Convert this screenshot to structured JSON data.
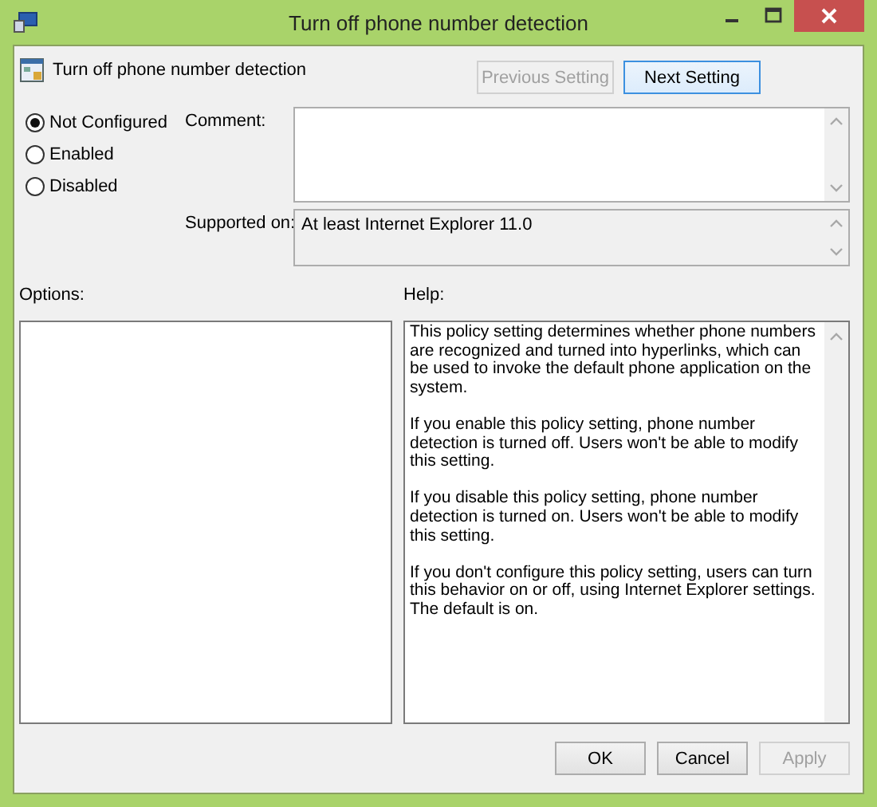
{
  "window": {
    "title": "Turn off phone number detection"
  },
  "policy_name": "Turn off phone number detection",
  "nav_buttons": [
    {
      "label": "Previous Setting",
      "disabled": true
    },
    {
      "label": "Next Setting",
      "disabled": false
    }
  ],
  "states": [
    {
      "label": "Not Configured",
      "selected": true
    },
    {
      "label": "Enabled",
      "selected": false
    },
    {
      "label": "Disabled",
      "selected": false
    }
  ],
  "comment": {
    "label": "Comment:"
  },
  "supported_on": {
    "label": "Supported on:",
    "value": "At least Internet Explorer 11.0"
  },
  "options": {
    "label": "Options:"
  },
  "help": {
    "label": "Help:",
    "paragraphs": [
      "This policy setting determines whether phone numbers are recognized and turned into hyperlinks, which can be used to invoke the default phone application on the system.",
      "If you enable this policy setting, phone number detection is turned off. Users won't be able to modify this setting.",
      "If you disable this policy setting, phone number detection is turned on. Users won't be able to modify this setting.",
      "If you don't configure this policy setting, users can turn this behavior on or off, using Internet Explorer settings. The default is on."
    ]
  },
  "buttons": [
    {
      "label": "OK",
      "disabled": false
    },
    {
      "label": "Cancel",
      "disabled": false
    },
    {
      "label": "Apply",
      "disabled": true
    }
  ]
}
